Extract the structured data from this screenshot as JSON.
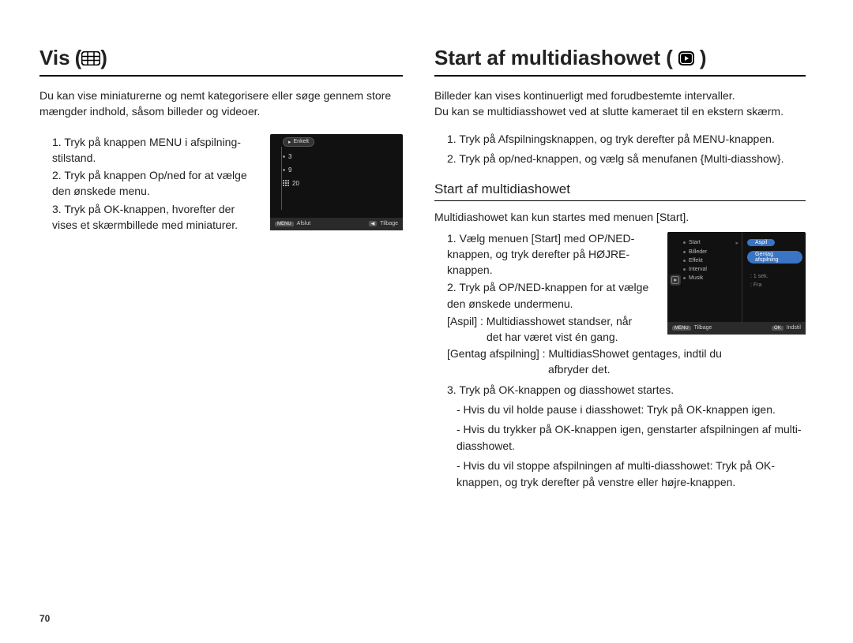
{
  "page_number": "70",
  "left": {
    "heading": "Vis",
    "intro": "Du kan vise miniaturerne og nemt kategorisere eller søge gennem store mængder indhold, såsom billeder og videoer.",
    "steps": [
      "1. Tryk på knappen MENU i afspilning-stilstand.",
      "2. Tryk på knappen Op/ned for at vælge den ønskede menu.",
      "3. Tryk på OK-knappen, hvorefter der vises et skærmbillede med miniaturer."
    ],
    "screen": {
      "top_label": "Enkelt",
      "rows": [
        "3",
        "9",
        "20"
      ],
      "bar_menu": "MENU",
      "bar_afslut": "Afslut",
      "bar_back_icon": "◀",
      "bar_tilbage": "Tilbage"
    }
  },
  "right": {
    "heading": "Start af multidiashowet (",
    "heading_close": ")",
    "intro1": "Billeder kan vises kontinuerligt med forudbestemte intervaller.",
    "intro2": "Du kan se multidiasshowet ved at slutte kameraet til en ekstern skærm.",
    "steps_top": [
      "1. Tryk på Afspilningsknappen, og tryk derefter på MENU-knappen.",
      "2. Tryk på op/ned-knappen, og vælg så menufanen {Multi-diasshow}."
    ],
    "subheading": "Start af multidiashowet",
    "sub_intro": "Multidiashowet kan kun startes med menuen [Start].",
    "steps_a": [
      "1. Vælg menuen [Start] med OP/NED-knappen, og tryk derefter på HØJRE-knappen.",
      "2. Tryk på OP/NED-knappen for at vælge den ønskede undermenu."
    ],
    "defs": {
      "aspil_term": "[Aspil]",
      "aspil_val1": ": Multidiasshowet standser, når",
      "aspil_val2": "det har været vist én gang.",
      "gentag_term": "[Gentag afspilning]",
      "gentag_val1": ": MultidiasShowet gentages, indtil du",
      "gentag_val2": "afbryder det."
    },
    "steps_b": [
      "3. Tryk på OK-knappen og diasshowet startes.",
      "- Hvis du vil holde pause i diasshowet: Tryk på OK-knappen igen.",
      "- Hvis du trykker på OK-knappen igen, genstarter afspilningen af multi-diasshowet.",
      "- Hvis du vil stoppe afspilningen af multi-diasshowet: Tryk på OK-knappen, og tryk derefter på venstre eller højre-knappen."
    ],
    "screen": {
      "menu": [
        "Start",
        "Billeder",
        "Effekt",
        "Interval",
        "Musik"
      ],
      "right_pills": [
        "Aspil",
        "Gentag afspilning"
      ],
      "right_vals": [
        ": 1 sek.",
        ": Fra"
      ],
      "bar_menu": "MENU",
      "bar_tilbage": "Tilbage",
      "bar_ok": "OK",
      "bar_indstil": "Indstil"
    }
  }
}
